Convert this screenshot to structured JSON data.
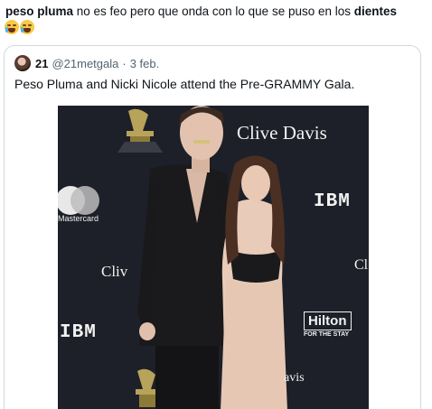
{
  "tweet": {
    "text_bold_1": "peso pluma",
    "text_mid": " no es feo pero que onda con lo que se puso en los ",
    "text_bold_2": "dientes",
    "emojis": [
      "crying-face-emoji",
      "crying-face-emoji"
    ]
  },
  "quote": {
    "author_name": "21",
    "author_handle": "@21metgala",
    "separator": "·",
    "date": "3 feb.",
    "text": "Peso Pluma and Nicki Nicole attend the Pre-GRAMMY Gala.",
    "image": {
      "subject": "red-carpet-photo",
      "backdrop_logos": [
        "Clive Davis",
        "IBM",
        "Hilton",
        "FOR THE STAY",
        "Mastercard",
        "Cliv",
        "Cl",
        "IBM",
        "avis"
      ]
    }
  },
  "colors": {
    "text": "#0f1419",
    "muted": "#536471",
    "border": "#cfd9de",
    "backdrop": "#1d2029"
  }
}
